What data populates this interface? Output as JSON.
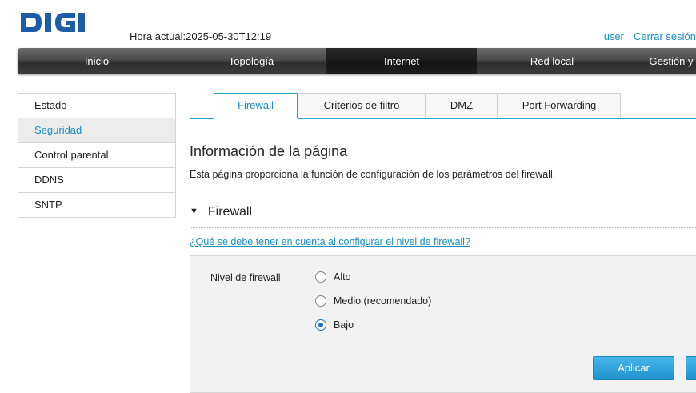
{
  "brand": {
    "logo_text": "DIGI",
    "color": "#1d5ca8"
  },
  "header": {
    "clock_label": "Hora actual:",
    "clock_value": "2025-05-30T12:19",
    "user_link": "user",
    "logout_link": "Cerrar sesión"
  },
  "nav": {
    "items": [
      {
        "label": "Inicio"
      },
      {
        "label": "Topología"
      },
      {
        "label": "Internet",
        "active": true
      },
      {
        "label": "Red local"
      },
      {
        "label": "Gestión y"
      }
    ]
  },
  "sidebar": {
    "items": [
      {
        "label": "Estado"
      },
      {
        "label": "Seguridad",
        "active": true
      },
      {
        "label": "Control parental"
      },
      {
        "label": "DDNS"
      },
      {
        "label": "SNTP"
      }
    ]
  },
  "tabs": [
    {
      "label": "Firewall",
      "active": true
    },
    {
      "label": "Criterios de filtro"
    },
    {
      "label": "DMZ"
    },
    {
      "label": "Port Forwarding"
    }
  ],
  "page": {
    "title": "Información de la página",
    "description": "Esta página proporciona la función de configuración de los parámetros del firewall."
  },
  "section": {
    "title": "Firewall",
    "icon": "triangle-down-icon",
    "help_link": "¿Qué se debe tener en cuenta al configurar el nivel de firewall?"
  },
  "firewall": {
    "label": "Nivel de firewall",
    "options": [
      {
        "label": "Alto",
        "checked": false
      },
      {
        "label": "Medio (recomendado)",
        "checked": false
      },
      {
        "label": "Bajo",
        "checked": true
      }
    ],
    "apply_label": "Aplicar"
  },
  "colors": {
    "accent": "#1a8fc2",
    "tab_border": "#2aa0d4"
  }
}
